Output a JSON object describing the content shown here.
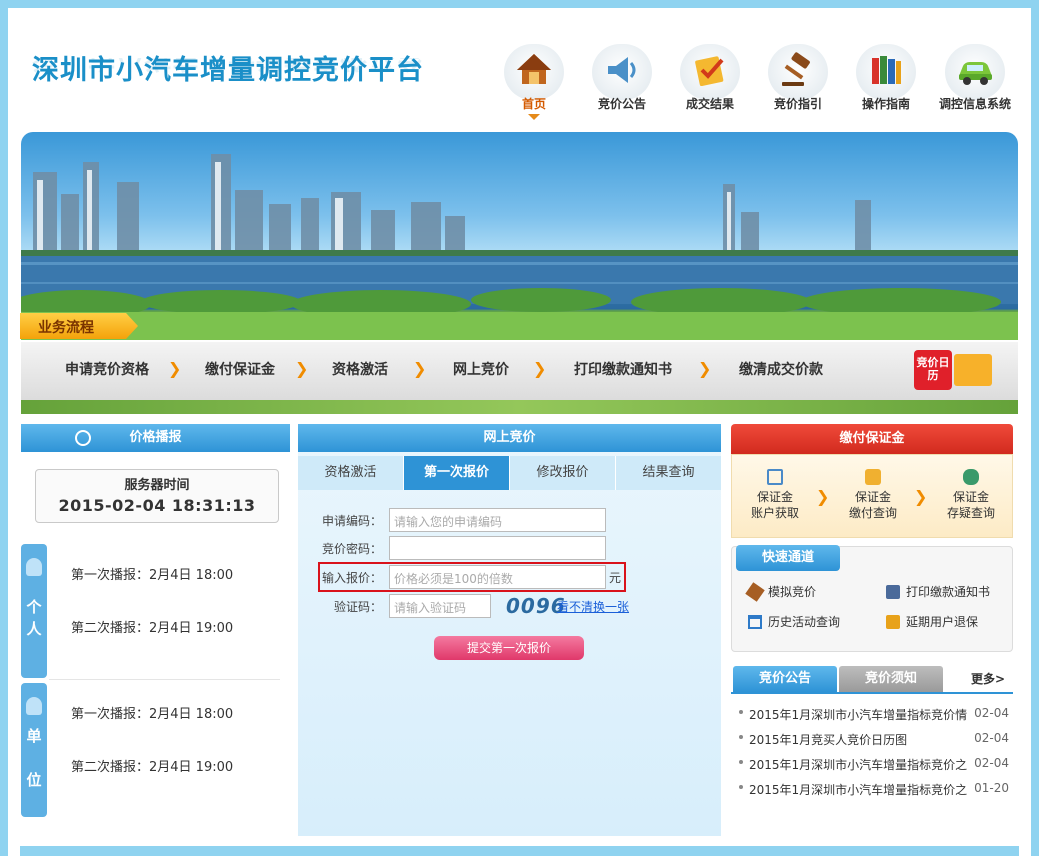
{
  "header": {
    "logo": "深圳市小汽车增量调控竞价平台",
    "nav": [
      {
        "label": "首页",
        "icon": "home-icon",
        "active": true
      },
      {
        "label": "竞价公告",
        "icon": "speaker-icon"
      },
      {
        "label": "成交结果",
        "icon": "checklist-icon"
      },
      {
        "label": "竞价指引",
        "icon": "gavel-icon"
      },
      {
        "label": "操作指南",
        "icon": "books-icon"
      },
      {
        "label": "调控信息系统",
        "icon": "car-icon"
      }
    ]
  },
  "process": {
    "tag": "业务流程",
    "steps": [
      "申请竞价资格",
      "缴付保证金",
      "资格激活",
      "网上竞价",
      "打印缴款通知书",
      "缴清成交价款"
    ],
    "calendar_label": "竞价日历"
  },
  "price_broadcast": {
    "title": "价格播报",
    "server_time_label": "服务器时间",
    "server_time": "2015-02-04 18:31:13",
    "personal": {
      "tab": "个人",
      "first": "第一次播报：2月4日 18:00",
      "second": "第二次播报：2月4日 19:00"
    },
    "company": {
      "tab": "单位",
      "first": "第一次播报：2月4日 18:00",
      "second": "第二次播报：2月4日 19:00"
    }
  },
  "online_bid": {
    "title": "网上竞价",
    "tabs": [
      "资格激活",
      "第一次报价",
      "修改报价",
      "结果查询"
    ],
    "active_tab": 1,
    "fields": {
      "apply_code_label": "申请编码：",
      "apply_code_placeholder": "请输入您的申请编码",
      "password_label": "竞价密码：",
      "price_label": "输入报价：",
      "price_placeholder": "价格必须是100的倍数",
      "price_unit": "元",
      "captcha_label": "验证码：",
      "captcha_placeholder": "请输入验证码",
      "captcha_value": "0096",
      "captcha_refresh": "看不清换一张"
    },
    "submit_label": "提交第一次报价"
  },
  "deposit": {
    "title": "缴付保证金",
    "items": [
      {
        "line1": "保证金",
        "line2": "账户获取",
        "icon": "search-doc-icon"
      },
      {
        "line1": "保证金",
        "line2": "缴付查询",
        "icon": "coin-search-icon"
      },
      {
        "line1": "保证金",
        "line2": "存疑查询",
        "icon": "binoculars-icon"
      }
    ]
  },
  "quick": {
    "title": "快速通道",
    "items": [
      {
        "label": "模拟竞价",
        "icon": "gavel-small-icon"
      },
      {
        "label": "打印缴款通知书",
        "icon": "printer-icon"
      },
      {
        "label": "历史活动查询",
        "icon": "calendar-icon"
      },
      {
        "label": "延期用户退保",
        "icon": "clipboard-icon"
      }
    ]
  },
  "notices": {
    "tabs": [
      "竞价公告",
      "竞价须知"
    ],
    "more": "更多>",
    "items": [
      {
        "title": "2015年1月深圳市小汽车增量指标竞价情",
        "date": "02-04"
      },
      {
        "title": "2015年1月竞买人竞价日历图",
        "date": "02-04"
      },
      {
        "title": "2015年1月深圳市小汽车增量指标竞价之",
        "date": "02-04"
      },
      {
        "title": "2015年1月深圳市小汽车增量指标竞价之",
        "date": "01-20"
      }
    ]
  },
  "colors": {
    "primary": "#2e93d6",
    "alert": "#d9121b",
    "accent": "#f08c00",
    "submit": "#e0386a"
  }
}
